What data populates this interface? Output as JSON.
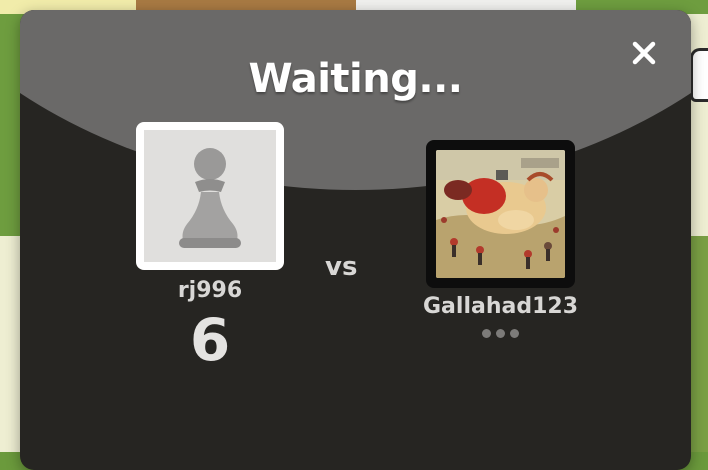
{
  "dialog": {
    "title": "Waiting...",
    "close_icon": "close-icon"
  },
  "player_left": {
    "username": "rj996",
    "score": "6",
    "avatar_icon": "pawn-icon"
  },
  "versus_label": "vs",
  "player_right": {
    "username": "Gallahad123",
    "avatar_image": "illustrated-battle-scene-avatar",
    "status_icon": "typing-dots-icon"
  },
  "colors": {
    "modal_bg": "#262522",
    "modal_header": "#6a6968",
    "board_green": "#6e9d3f",
    "board_light": "#eeeed2"
  }
}
